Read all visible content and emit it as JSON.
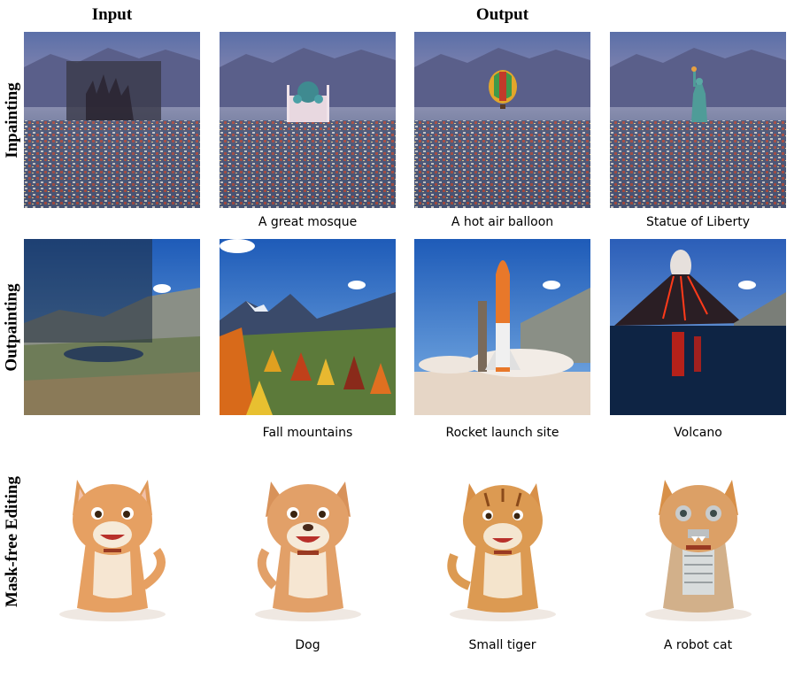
{
  "headers": {
    "input": "Input",
    "output": "Output"
  },
  "row_labels": [
    "Inpainting",
    "Outpainting",
    "Mask-free Editing"
  ],
  "captions": {
    "inpainting": [
      "A great mosque",
      "A hot air balloon",
      "Statue of Liberty"
    ],
    "outpainting": [
      "Fall mountains",
      "Rocket launch site",
      "Volcano"
    ],
    "editing": [
      "Dog",
      "Small tiger",
      "A robot cat"
    ]
  }
}
